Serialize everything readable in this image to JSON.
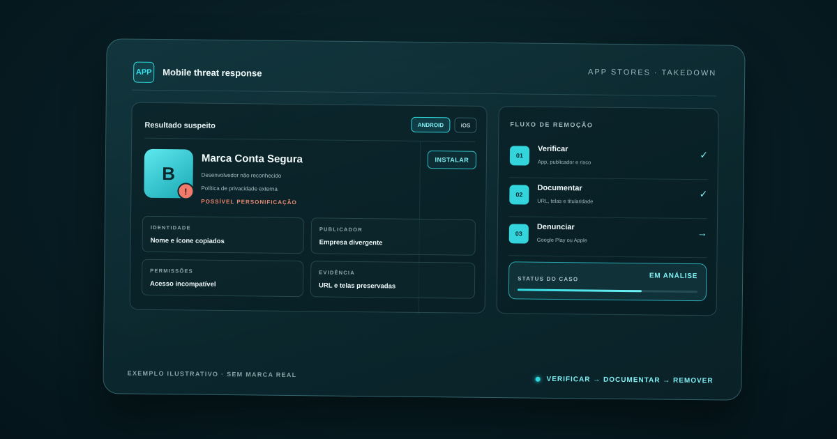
{
  "header": {
    "badge": "APP",
    "title": "Mobile threat response",
    "context": "APP STORES · TAKEDOWN"
  },
  "result": {
    "title": "Resultado suspeito",
    "platforms": [
      "ANDROID",
      "iOS"
    ],
    "selected_platform": "ANDROID",
    "app": {
      "icon_letter": "B",
      "warning_symbol": "!",
      "name": "Marca Conta Segura",
      "line1": "Desenvolvedor não reconhecido",
      "line2": "Política de privacidade externa",
      "alert": "POSSÍVEL PERSONIFICAÇÃO"
    },
    "install_label": "INSTALAR",
    "cells": [
      {
        "label": "IDENTIDADE",
        "value": "Nome e ícone copiados"
      },
      {
        "label": "PUBLICADOR",
        "value": "Empresa divergente"
      },
      {
        "label": "PERMISSÕES",
        "value": "Acesso incompatível"
      },
      {
        "label": "EVIDÊNCIA",
        "value": "URL e telas preservadas"
      }
    ]
  },
  "flow": {
    "title": "FLUXO DE REMOÇÃO",
    "steps": [
      {
        "num": "01",
        "name": "Verificar",
        "sub": "App, publicador e risco",
        "mark": "✓"
      },
      {
        "num": "02",
        "name": "Documentar",
        "sub": "URL, telas e titularidade",
        "mark": "✓"
      },
      {
        "num": "03",
        "name": "Denunciar",
        "sub": "Google Play ou Apple",
        "mark": "→"
      }
    ],
    "status": {
      "label": "STATUS DO CASO",
      "value": "EM ANÁLISE",
      "progress": 0.69
    }
  },
  "footer": {
    "left": "EXEMPLO ILUSTRATIVO · SEM MARCA REAL",
    "right": "VERIFICAR → DOCUMENTAR → REMOVER"
  },
  "colors": {
    "accent": "#2fd6de",
    "alert": "#f08a72",
    "background": "#082026"
  },
  "icons": {
    "check": "check-icon",
    "arrow": "arrow-right-icon",
    "warning": "warning-icon"
  }
}
